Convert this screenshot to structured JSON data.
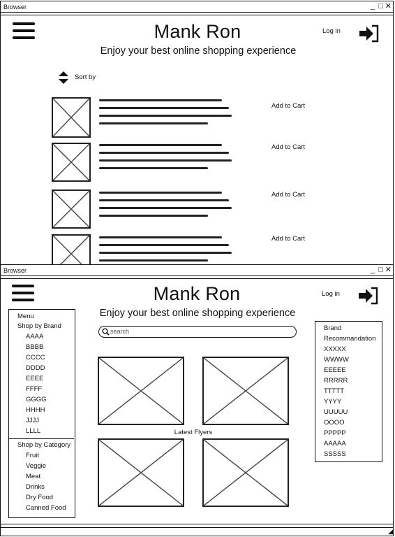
{
  "windows": [
    {
      "title": "Browser",
      "brand": "Mank Ron",
      "tagline": "Enjoy your best online shopping experience",
      "login_label": "Log in",
      "sort_label": "Sort by",
      "products": [
        {
          "add_to_cart": "Add to Cart"
        },
        {
          "add_to_cart": "Add to Cart"
        },
        {
          "add_to_cart": "Add to Cart"
        },
        {
          "add_to_cart": "Add to Cart"
        }
      ]
    },
    {
      "title": "Browser",
      "brand": "Mank Ron",
      "tagline": "Enjoy your best online shopping experience",
      "login_label": "Log in",
      "search_placeholder": "search",
      "latest_flyers_label": "Latest Flyers",
      "menu": {
        "title": "Menu",
        "brand_header": "Shop by Brand",
        "brands": [
          "AAAA",
          "BBBB",
          "CCCC",
          "DDDD",
          "EEEE",
          "FFFF",
          "GGGG",
          "HHHH",
          "JJJJ",
          "LLLL"
        ],
        "category_header": "Shop by Category",
        "categories": [
          "Fruit",
          "Veggie",
          "Meat",
          "Drinks",
          "Dry Food",
          "Canned Food"
        ]
      },
      "recommendation": {
        "title_line1": "Brand",
        "title_line2": "Recommandation",
        "items": [
          "XXXXX",
          "WWWW",
          "EEEEE",
          "RRRRR",
          "TTTTT",
          "YYYY",
          "UUUUU",
          "OOOO",
          "PPPPP",
          "AAAAA",
          "SSSSS"
        ]
      }
    }
  ],
  "icons": {
    "menu": "hamburger-icon",
    "login": "sign-in-icon",
    "sort": "sort-icon",
    "search": "search-icon",
    "image": "image-placeholder-icon",
    "window_controls": [
      "minimize-icon",
      "maximize-icon",
      "close-icon"
    ],
    "resize": "resize-grip-icon"
  }
}
